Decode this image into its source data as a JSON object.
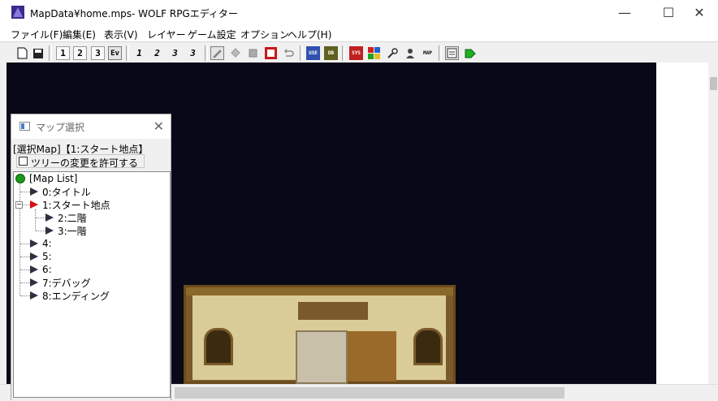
{
  "window": {
    "title": "MapData¥home.mps- WOLF RPGエディター",
    "minimize": "—",
    "maximize": "☐",
    "close": "✕"
  },
  "menu": [
    {
      "label": "ファイル(F)"
    },
    {
      "label": "編集(E)"
    },
    {
      "label": "表示(V)"
    },
    {
      "label": "レイヤー"
    },
    {
      "label": "ゲーム設定"
    },
    {
      "label": "オプション"
    },
    {
      "label": "ヘルプ(H)"
    }
  ],
  "toolbar": {
    "layer1": "1",
    "layer2": "2",
    "layer3": "3",
    "event_layer": "Ev",
    "layer1_upper": "1",
    "layer2_upper": "2",
    "layer3_upper": "3",
    "layer_all_upper": "3",
    "map_button": "MAP",
    "user_db": "USE",
    "variable_db": "DB",
    "system_db": "SYS"
  },
  "map_dialog": {
    "title": "マップ選択",
    "close": "✕",
    "selected_label": "[選択Map]【1:スタート地点】",
    "allow_tree_change": "ツリーの変更を許可する",
    "allow_tree_change_checked": false,
    "tree": {
      "root": "[Map List]",
      "items": [
        {
          "label": "0:タイトル",
          "level": 1,
          "active": false
        },
        {
          "label": "1:スタート地点",
          "level": 1,
          "active": true,
          "expanded": true
        },
        {
          "label": "2:二階",
          "level": 2,
          "active": false
        },
        {
          "label": "3:一階",
          "level": 2,
          "active": false
        },
        {
          "label": "4:",
          "level": 1,
          "active": false
        },
        {
          "label": "5:",
          "level": 1,
          "active": false
        },
        {
          "label": "6:",
          "level": 1,
          "active": false
        },
        {
          "label": "7:デバッグ",
          "level": 1,
          "active": false
        },
        {
          "label": "8:エンディング",
          "level": 1,
          "active": false
        }
      ]
    }
  },
  "colors": {
    "canvas_bg": "#080818",
    "root_node": "#1a9a1a",
    "active_map": "#d81010"
  }
}
